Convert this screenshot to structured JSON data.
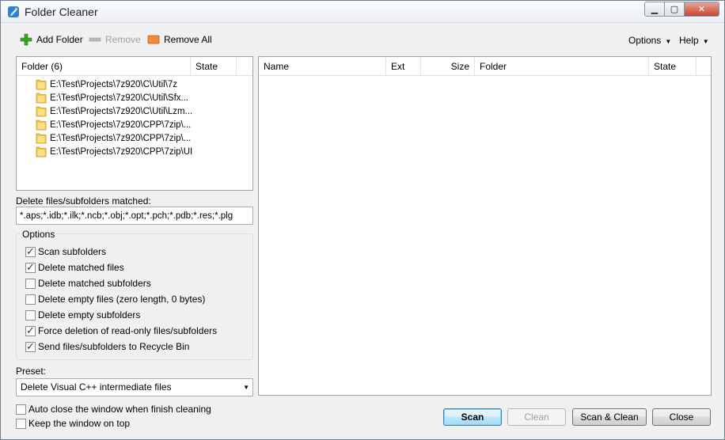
{
  "window": {
    "title": "Folder Cleaner",
    "icon": "broom-icon"
  },
  "toolbar": {
    "add_folder": "Add Folder",
    "remove": "Remove",
    "remove_all": "Remove All",
    "options": "Options",
    "help": "Help"
  },
  "folders": {
    "header_folder": "Folder (6)",
    "header_state": "State",
    "items": [
      "E:\\Test\\Projects\\7z920\\C\\Util\\7z",
      "E:\\Test\\Projects\\7z920\\C\\Util\\Sfx...",
      "E:\\Test\\Projects\\7z920\\C\\Util\\Lzm...",
      "E:\\Test\\Projects\\7z920\\CPP\\7zip\\...",
      "E:\\Test\\Projects\\7z920\\CPP\\7zip\\...",
      "E:\\Test\\Projects\\7z920\\CPP\\7zip\\UI"
    ]
  },
  "results": {
    "columns": [
      "Name",
      "Ext",
      "Size",
      "Folder",
      "State"
    ]
  },
  "filter": {
    "label": "Delete files/subfolders matched:",
    "value": "*.aps;*.idb;*.ilk;*.ncb;*.obj;*.opt;*.pch;*.pdb;*.res;*.plg"
  },
  "options": {
    "title": "Options",
    "items": [
      {
        "label": "Scan subfolders",
        "checked": true
      },
      {
        "label": "Delete matched files",
        "checked": true
      },
      {
        "label": "Delete matched subfolders",
        "checked": false
      },
      {
        "label": "Delete empty files (zero length, 0 bytes)",
        "checked": false
      },
      {
        "label": "Delete empty subfolders",
        "checked": false
      },
      {
        "label": "Force deletion of read-only files/subfolders",
        "checked": true
      },
      {
        "label": "Send files/subfolders to Recycle Bin",
        "checked": true
      }
    ]
  },
  "preset": {
    "label": "Preset:",
    "value": "Delete Visual C++ intermediate files"
  },
  "bottom": {
    "auto_close": {
      "label": "Auto close the window when finish cleaning",
      "checked": false
    },
    "keep_top": {
      "label": "Keep the window on top",
      "checked": false
    }
  },
  "buttons": {
    "scan": "Scan",
    "clean": "Clean",
    "scan_clean": "Scan & Clean",
    "close": "Close"
  },
  "colors": {
    "accent_green": "#3aa627",
    "remove_all_orange": "#f08a3c",
    "folder_yellow": "#f2c64d"
  }
}
